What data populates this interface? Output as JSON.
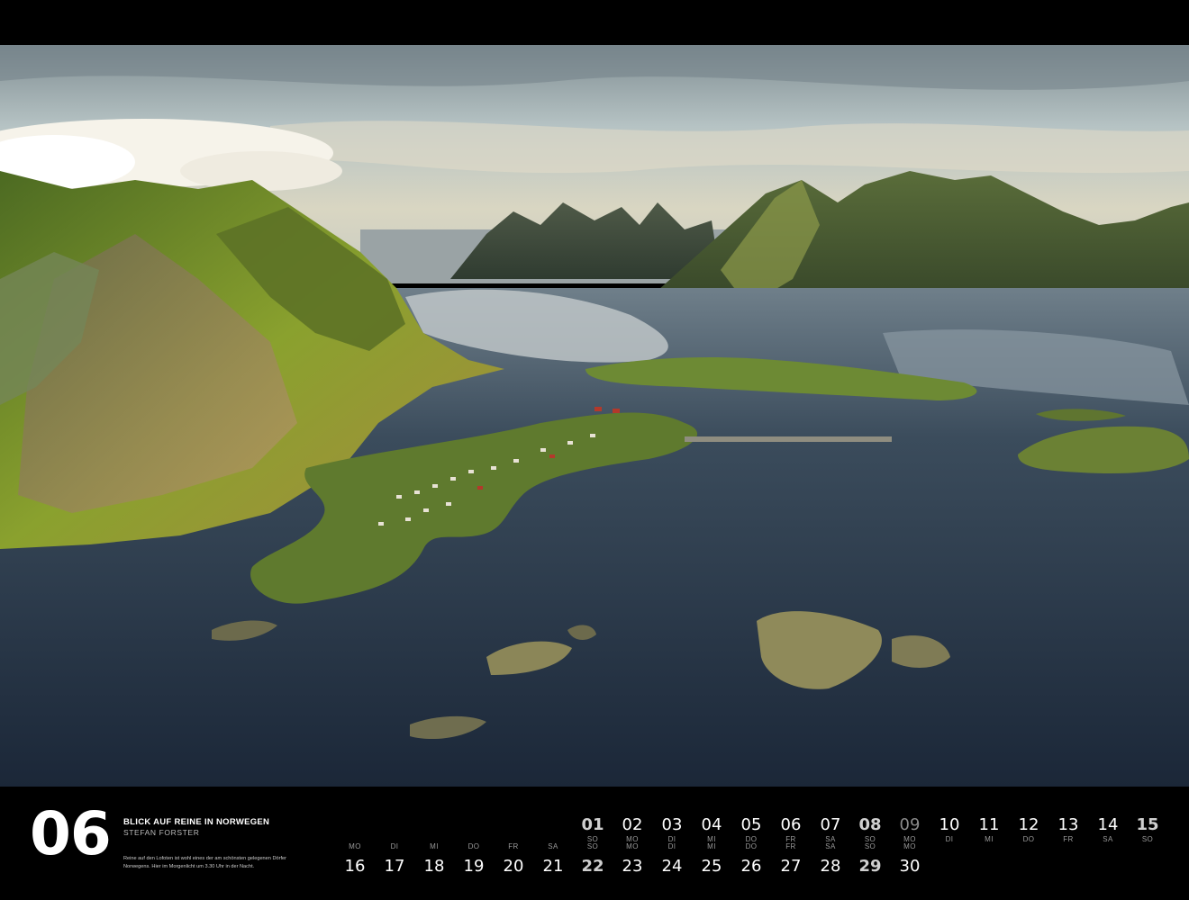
{
  "month": "06",
  "title": "BLICK AUF REINE IN NORWEGEN",
  "author": "STEFAN FORSTER",
  "description": "Reine auf den Lofoten ist wohl eines der am schönsten gelegenen Dörfer Norwegens. Hier im Morgenlicht um 3.30 Uhr in der Nacht.",
  "days_row1": [
    {
      "num": "01",
      "name": "SO"
    },
    {
      "num": "02",
      "name": "MO"
    },
    {
      "num": "03",
      "name": "DI"
    },
    {
      "num": "04",
      "name": "MI"
    },
    {
      "num": "05",
      "name": "DO"
    },
    {
      "num": "06",
      "name": "FR"
    },
    {
      "num": "07",
      "name": "SA"
    },
    {
      "num": "08",
      "name": "SO"
    },
    {
      "num": "09",
      "name": "MO"
    },
    {
      "num": "10",
      "name": "DI"
    },
    {
      "num": "11",
      "name": "MI"
    },
    {
      "num": "12",
      "name": "DO"
    },
    {
      "num": "13",
      "name": "FR"
    },
    {
      "num": "14",
      "name": "SA"
    },
    {
      "num": "15",
      "name": "SO"
    }
  ],
  "days_row2": [
    {
      "num": "16",
      "name": "MO"
    },
    {
      "num": "17",
      "name": "DI"
    },
    {
      "num": "18",
      "name": "MI"
    },
    {
      "num": "19",
      "name": "DO"
    },
    {
      "num": "20",
      "name": "FR"
    },
    {
      "num": "21",
      "name": "SA"
    },
    {
      "num": "22",
      "name": "SO"
    },
    {
      "num": "23",
      "name": "MO"
    },
    {
      "num": "24",
      "name": "DI"
    },
    {
      "num": "25",
      "name": "MI"
    },
    {
      "num": "26",
      "name": "DO"
    },
    {
      "num": "27",
      "name": "FR"
    },
    {
      "num": "28",
      "name": "SA"
    },
    {
      "num": "29",
      "name": "SO"
    },
    {
      "num": "30",
      "name": "MO"
    }
  ],
  "colors": {
    "background": "#000000",
    "sunday": "#cfcfcf",
    "holiday": "#8a8a8a",
    "weekday_label": "#9a9a9a"
  }
}
